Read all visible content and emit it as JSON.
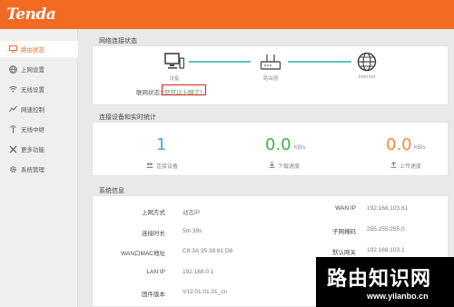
{
  "brand": {
    "logo": "Tenda",
    "accent": "#f26b21"
  },
  "sidebar": {
    "items": [
      {
        "label": "路由状态",
        "icon": "monitor-icon",
        "active": true
      },
      {
        "label": "上网设置",
        "icon": "globe-icon"
      },
      {
        "label": "无线设置",
        "icon": "wifi-icon"
      },
      {
        "label": "网速控制",
        "icon": "speed-icon"
      },
      {
        "label": "无线中继",
        "icon": "relay-icon"
      },
      {
        "label": "更多功能",
        "icon": "tools-icon"
      },
      {
        "label": "系统管理",
        "icon": "gear-icon"
      }
    ]
  },
  "connection": {
    "title": "网络连接状态",
    "nodes": [
      "设备",
      "路由器",
      "Internet"
    ],
    "status_label": "联网状态：",
    "status_value": "您可以上网了！"
  },
  "stats": {
    "title": "连接设备和实时统计",
    "devices": {
      "value": "1",
      "label": "连接设备",
      "color": "#3fb0c4"
    },
    "download": {
      "value": "0.0",
      "unit": "KB/s",
      "label": "下载速度",
      "color": "#3cb54a"
    },
    "upload": {
      "value": "0.0",
      "unit": "KB/s",
      "label": "上传速度",
      "color": "#f28c38"
    }
  },
  "system": {
    "title": "系统信息",
    "left": [
      {
        "label": "上网方式",
        "value": "动态IP"
      },
      {
        "label": "连接时长",
        "value": "5m 39s"
      },
      {
        "label": "WAN口MAC地址",
        "value": "C8:3A:35:38:61:D8"
      },
      {
        "label": "LAN IP",
        "value": "192.168.0.1"
      },
      {
        "label": "固件版本",
        "value": "V12.01.01.01_cn"
      }
    ],
    "right": [
      {
        "label": "WAN IP",
        "value": "192.168.103.61"
      },
      {
        "label": "子网掩码",
        "value": "255.255.255.0"
      },
      {
        "label": "默认网关",
        "value": "192.168.103.1"
      }
    ]
  },
  "watermark": {
    "text": "路由知识网",
    "url": "www.yilanbo.cn"
  }
}
